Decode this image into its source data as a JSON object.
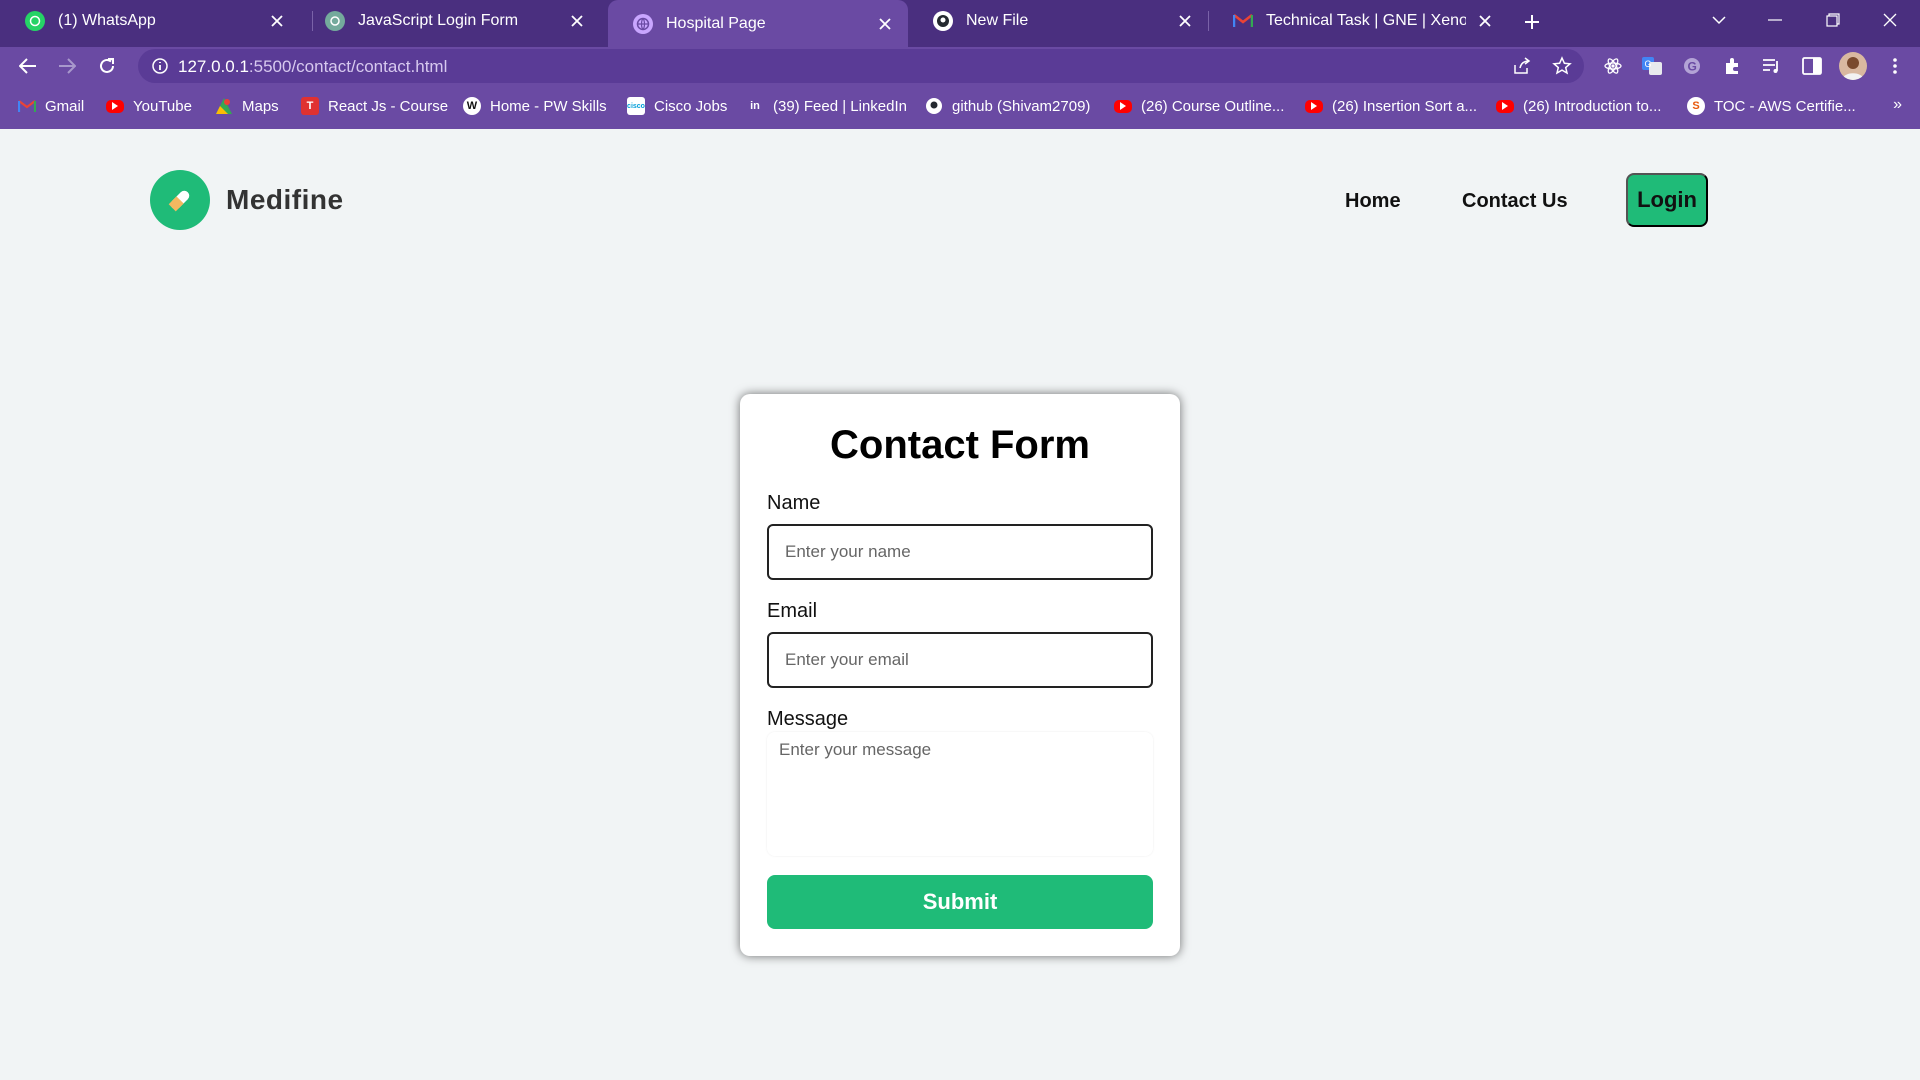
{
  "browser": {
    "tabs": [
      {
        "title": "(1) WhatsApp",
        "icon": "whatsapp-icon",
        "active": false
      },
      {
        "title": "JavaScript Login Form",
        "icon": "openai-icon",
        "active": false
      },
      {
        "title": "Hospital Page",
        "icon": "globe-icon",
        "active": true
      },
      {
        "title": "New File",
        "icon": "github-icon",
        "active": false
      },
      {
        "title": "Technical Task | GNE | XenonStack",
        "icon": "gmail-icon",
        "active": false
      }
    ],
    "url_host": "127.0.0.1",
    "url_path": ":5500/contact/contact.html",
    "bookmarks": [
      {
        "label": "Gmail",
        "icon": "gmail-icon"
      },
      {
        "label": "YouTube",
        "icon": "youtube-icon"
      },
      {
        "label": "Maps",
        "icon": "maps-icon"
      },
      {
        "label": "React Js - Course",
        "icon": "course-icon"
      },
      {
        "label": "Home - PW Skills",
        "icon": "pw-skills-icon"
      },
      {
        "label": "Cisco Jobs",
        "icon": "cisco-icon"
      },
      {
        "label": "(39) Feed | LinkedIn",
        "icon": "linkedin-icon"
      },
      {
        "label": "github (Shivam2709)",
        "icon": "github-icon"
      },
      {
        "label": "(26) Course Outline...",
        "icon": "youtube-icon"
      },
      {
        "label": "(26) Insertion Sort a...",
        "icon": "youtube-icon"
      },
      {
        "label": "(26) Introduction to...",
        "icon": "youtube-icon"
      },
      {
        "label": "TOC - AWS Certifie...",
        "icon": "aws-icon"
      }
    ],
    "theme_color": "#6a4aa3",
    "tabstrip_color": "#4a2f7f"
  },
  "site": {
    "brand": "Medifine",
    "nav": {
      "home": "Home",
      "contact": "Contact Us",
      "login": "Login"
    },
    "accent_color": "#1fbb78"
  },
  "form": {
    "title": "Contact Form",
    "name_label": "Name",
    "name_placeholder": "Enter your name",
    "email_label": "Email",
    "email_placeholder": "Enter your email",
    "message_label": "Message",
    "message_placeholder": "Enter your message",
    "submit_label": "Submit"
  }
}
